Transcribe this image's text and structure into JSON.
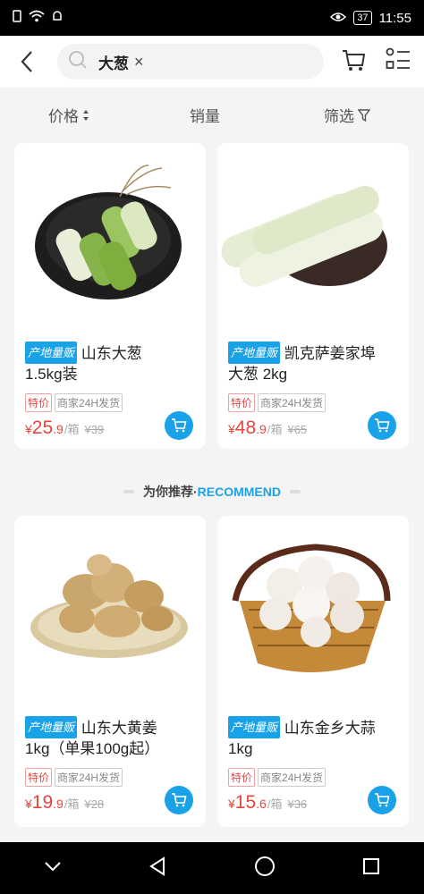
{
  "status": {
    "time": "11:55",
    "battery": "37"
  },
  "search": {
    "keyword": "大葱",
    "clear_symbol": "×"
  },
  "filters": [
    {
      "label": "价格",
      "icon": "sort-icon"
    },
    {
      "label": "销量"
    },
    {
      "label": "筛选",
      "icon": "filter-icon"
    }
  ],
  "products": [
    {
      "badge": "产地量贩",
      "name": "山东大葱",
      "name2": "1.5kg装",
      "tag1": "特价",
      "tag2": "商家24H发货",
      "currency": "¥",
      "price_int": "25",
      "price_dec": ".9",
      "unit": "/箱",
      "orig": "¥39"
    },
    {
      "badge": "产地量贩",
      "name": "凯克萨姜家埠",
      "name2": "大葱 2kg",
      "tag1": "特价",
      "tag2": "商家24H发货",
      "currency": "¥",
      "price_int": "48",
      "price_dec": ".9",
      "unit": "/箱",
      "orig": "¥65"
    },
    {
      "badge": "产地量贩",
      "name": "山东大黄姜",
      "name2": "1kg（单果100g起）",
      "tag1": "特价",
      "tag2": "商家24H发货",
      "currency": "¥",
      "price_int": "19",
      "price_dec": ".9",
      "unit": "/箱",
      "orig": "¥28"
    },
    {
      "badge": "产地量贩",
      "name": "山东金乡大蒜",
      "name2": "1kg",
      "tag1": "特价",
      "tag2": "商家24H发货",
      "currency": "¥",
      "price_int": "15",
      "price_dec": ".6",
      "unit": "/箱",
      "orig": "¥36"
    }
  ],
  "recommend": {
    "cn": "为你推荐·",
    "en": "RECOMMEND"
  },
  "colors": {
    "accent": "#1aa2e8",
    "price": "#e8453c"
  }
}
